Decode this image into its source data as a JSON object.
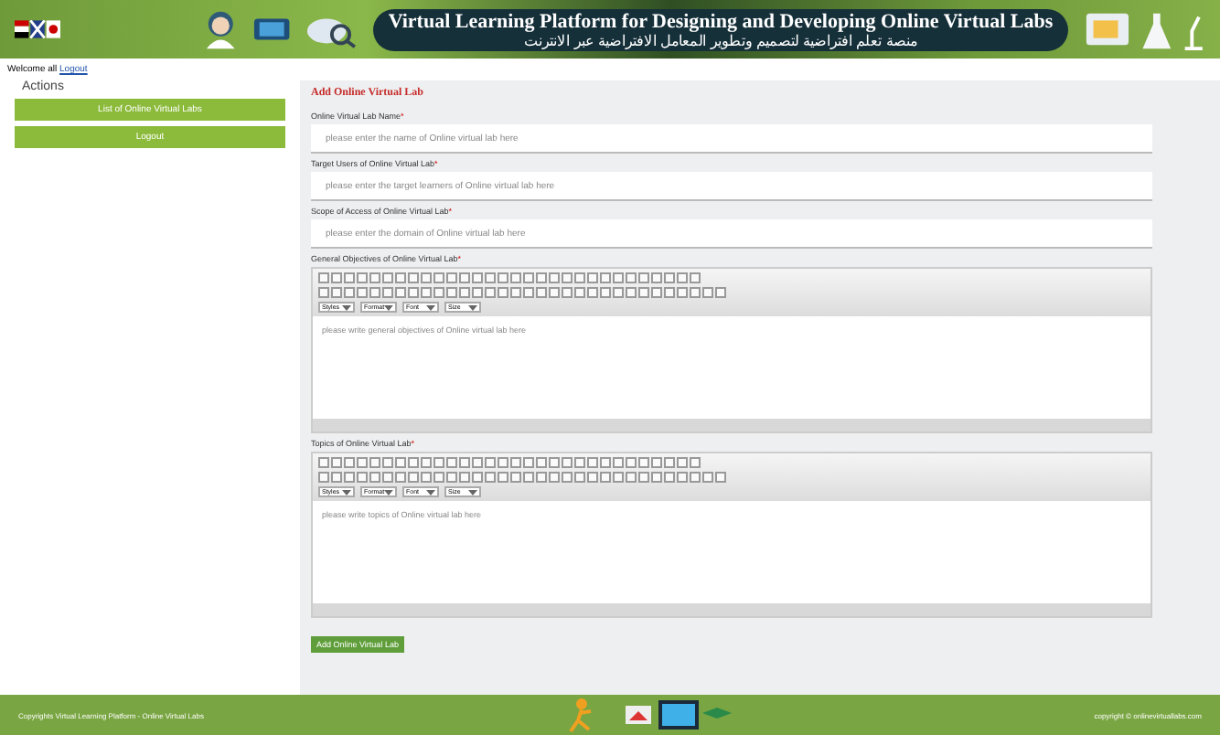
{
  "header": {
    "title": "Virtual Learning Platform for Designing and Developing Online Virtual Labs",
    "subtitle": "منصة تعلم افتراضية لتصميم وتطوير المعامل الافتراضية عبر الانترنت"
  },
  "user_bar": {
    "greeting": "Welcome all",
    "link": "Logout"
  },
  "sidebar": {
    "title": "Actions",
    "buttons": [
      "List of Online Virtual Labs",
      "Logout"
    ]
  },
  "form": {
    "title": "Add Online Virtual Lab",
    "fields": [
      {
        "kind": "input",
        "label": "Online Virtual Lab Name",
        "required_mark": "*",
        "placeholder": "please enter the name of Online virtual lab here"
      },
      {
        "kind": "input",
        "label": "Target Users of Online Virtual Lab",
        "required_mark": "*",
        "placeholder": "please enter the target learners of Online virtual lab here"
      },
      {
        "kind": "input",
        "label": "Scope of Access of Online Virtual Lab",
        "required_mark": "*",
        "placeholder": "please enter the domain of Online virtual lab here"
      },
      {
        "kind": "editor",
        "label": "General Objectives of Online Virtual Lab",
        "required_mark": "*",
        "placeholder": "please write general objectives of Online virtual lab here",
        "selects": [
          "Styles",
          "Format",
          "Font",
          "Size"
        ]
      },
      {
        "kind": "editor",
        "label": "Topics of Online Virtual Lab",
        "required_mark": "*",
        "placeholder": "please write topics of Online virtual lab here",
        "selects": [
          "Styles",
          "Format",
          "Font",
          "Size"
        ]
      }
    ],
    "submit": "Add Online Virtual Lab"
  },
  "footer": {
    "left": "Copyrights Virtual Learning Platform - Online Virtual Labs",
    "right": "copyright © onlinevirtuallabs.com"
  }
}
